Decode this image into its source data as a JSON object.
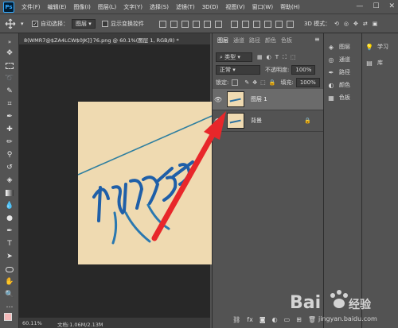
{
  "menubar": {
    "logo": "Ps",
    "items": [
      "文件(F)",
      "编辑(E)",
      "图像(I)",
      "图层(L)",
      "文字(Y)",
      "选择(S)",
      "滤镜(T)",
      "3D(D)",
      "视图(V)",
      "窗口(W)",
      "帮助(H)"
    ],
    "window_controls": [
      "—",
      "☐",
      "✕"
    ]
  },
  "options": {
    "auto_select_label": "自动选择：",
    "auto_select_value": "图层",
    "show_transform_label": "显示变换控件",
    "mode_label": "3D 模式："
  },
  "document": {
    "tab_title": "8(WMR7@$ZA4LCW$0JK]}76.png @ 60.1%(图层 1, RGB/8) *",
    "zoom": "60.11%",
    "doc_info": "文档:1.06M/2.13M"
  },
  "layers_panel": {
    "tabs": [
      "图层",
      "通道",
      "路径",
      "颜色",
      "色板"
    ],
    "kind_filter": "类型",
    "blend_mode": "正常",
    "opacity_label": "不透明度:",
    "opacity_value": "100%",
    "lock_label": "锁定:",
    "fill_label": "填充:",
    "fill_value": "100%",
    "layers": [
      {
        "name": "图层 1",
        "selected": true,
        "locked": false
      },
      {
        "name": "背景",
        "selected": false,
        "locked": true
      }
    ]
  },
  "mini_panel": {
    "items": [
      {
        "label": "图层",
        "icon": "layers-icon"
      },
      {
        "label": "通道",
        "icon": "channels-icon"
      },
      {
        "label": "路径",
        "icon": "paths-icon"
      },
      {
        "label": "颜色",
        "icon": "color-icon"
      },
      {
        "label": "色板",
        "icon": "swatches-icon"
      }
    ]
  },
  "learn_panel": {
    "items": [
      {
        "label": "学习",
        "icon": "lightbulb-icon"
      },
      {
        "label": "库",
        "icon": "library-icon"
      }
    ]
  },
  "colors": {
    "canvas_bg": "#efdab1",
    "arrow": "#e8272a",
    "accent": "#31a8ff"
  }
}
